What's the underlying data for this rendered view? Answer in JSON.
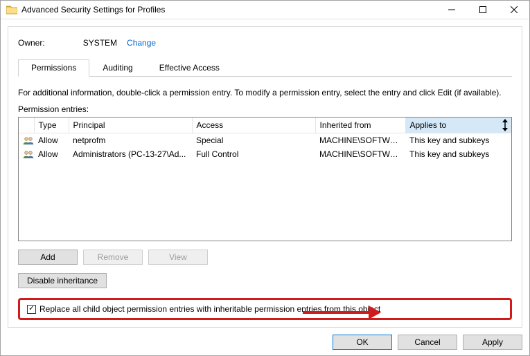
{
  "window": {
    "title": "Advanced Security Settings for Profiles"
  },
  "owner": {
    "label": "Owner:",
    "value": "SYSTEM",
    "change_link": "Change"
  },
  "tabs": {
    "permissions": "Permissions",
    "auditing": "Auditing",
    "effective": "Effective Access"
  },
  "desc": "For additional information, double-click a permission entry. To modify a permission entry, select the entry and click Edit (if available).",
  "entries_label": "Permission entries:",
  "columns": {
    "type": "Type",
    "principal": "Principal",
    "access": "Access",
    "inherited": "Inherited from",
    "applies": "Applies to"
  },
  "rows": [
    {
      "type": "Allow",
      "principal": "netprofm",
      "access": "Special",
      "inherited": "MACHINE\\SOFTWARE...",
      "applies": "This key and subkeys"
    },
    {
      "type": "Allow",
      "principal": "Administrators (PC-13-27\\Ad...",
      "access": "Full Control",
      "inherited": "MACHINE\\SOFTWARE...",
      "applies": "This key and subkeys"
    }
  ],
  "buttons": {
    "add": "Add",
    "remove": "Remove",
    "view": "View",
    "disable_inh": "Disable inheritance",
    "ok": "OK",
    "cancel": "Cancel",
    "apply": "Apply"
  },
  "checkbox": {
    "label": "Replace all child object permission entries with inheritable permission entries from this object",
    "checked": true
  }
}
